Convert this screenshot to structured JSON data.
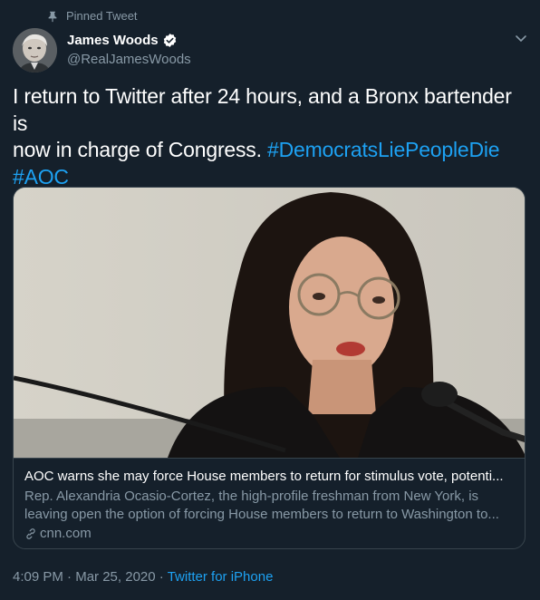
{
  "pinned_label": "Pinned Tweet",
  "author": {
    "name": "James Woods",
    "handle": "@RealJamesWoods",
    "verified": true
  },
  "tweet": {
    "text_line1": "I return to Twitter after 24 hours, and a Bronx bartender is",
    "text_line2_plain": "now in charge of Congress. ",
    "hashtag1": "#DemocratsLiePeopleDie",
    "hashtag2": "#AOC"
  },
  "card": {
    "title": "AOC warns she may force House members to return for stimulus vote, potenti...",
    "description_line1": "Rep. Alexandria Ocasio-Cortez, the high-profile freshman from New York, is",
    "description_line2": "leaving open the option of forcing House members to return to Washington to...",
    "domain": "cnn.com"
  },
  "meta": {
    "time": "4:09 PM",
    "separator": "·",
    "date": "Mar 25, 2020",
    "separator2": "·",
    "source": "Twitter for iPhone"
  },
  "colors": {
    "background": "#15202b",
    "accent": "#1da1f2",
    "secondary_text": "#8899a6",
    "border": "#38444d"
  },
  "icons": [
    "pin-icon",
    "verified-badge-icon",
    "chevron-down-icon",
    "link-icon"
  ]
}
